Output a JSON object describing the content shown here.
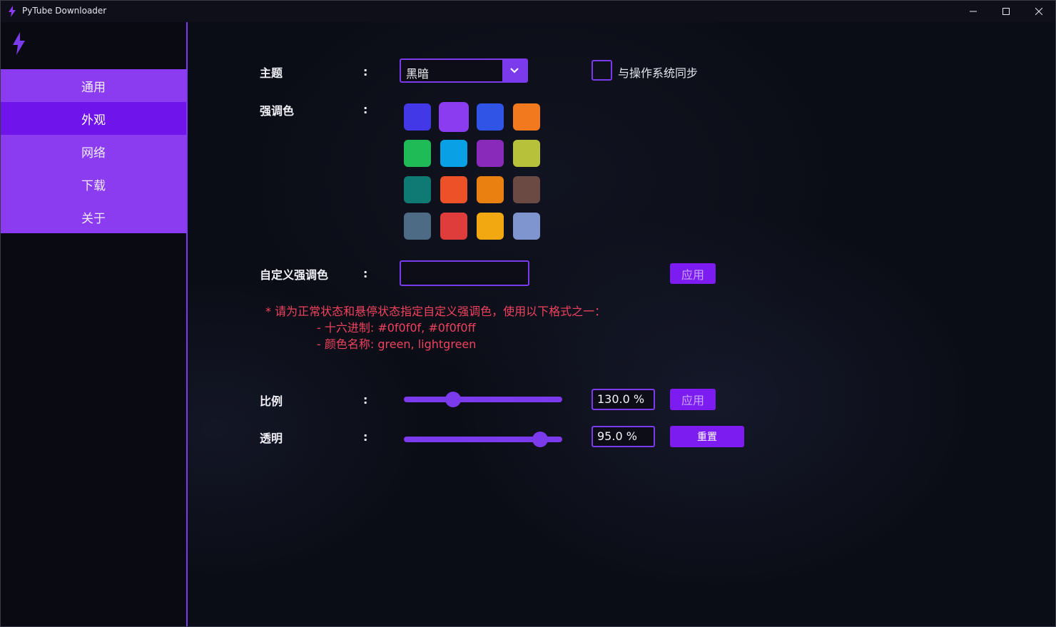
{
  "window": {
    "title": "PyTube Downloader"
  },
  "sidebar": {
    "items": [
      {
        "label": "通用"
      },
      {
        "label": "外观"
      },
      {
        "label": "网络"
      },
      {
        "label": "下载"
      },
      {
        "label": "关于"
      }
    ],
    "active_index": 1
  },
  "theme": {
    "label": "主题",
    "colon": ":",
    "value": "黑暗",
    "sync_label": "与操作系统同步",
    "sync_checked": false
  },
  "accent": {
    "label": "强调色",
    "colon": ":",
    "selected_index": 1,
    "swatches": [
      "#4338e8",
      "#8b3cf0",
      "#2f54e6",
      "#f3791f",
      "#1fbb57",
      "#0aa0e6",
      "#8a2aba",
      "#b7c23a",
      "#0f7a73",
      "#ec5128",
      "#ea8010",
      "#6b4a44",
      "#4d6b85",
      "#df3c3c",
      "#f2a810",
      "#7f95cf"
    ]
  },
  "custom_accent": {
    "label": "自定义强调色",
    "colon": ":",
    "value": "",
    "apply_label": "应用",
    "note_line1": "* 请为正常状态和悬停状态指定自定义强调色，使用以下格式之一：",
    "note_line2": "- 十六进制: #0f0f0f, #0f0f0ff",
    "note_line3": "- 颜色名称: green, lightgreen"
  },
  "scale": {
    "label": "比例",
    "colon": ":",
    "value_text": "130.0 %",
    "level": 0.31,
    "apply_label": "应用"
  },
  "opacity": {
    "label": "透明",
    "colon": ":",
    "value_text": "95.0 %",
    "level": 0.86,
    "reset_label": "重置"
  },
  "colors": {
    "accent": "#7c3aed",
    "nav_bg": "#8b3cf0",
    "nav_active": "#6f14ea",
    "warning_text": "#f0435e"
  }
}
